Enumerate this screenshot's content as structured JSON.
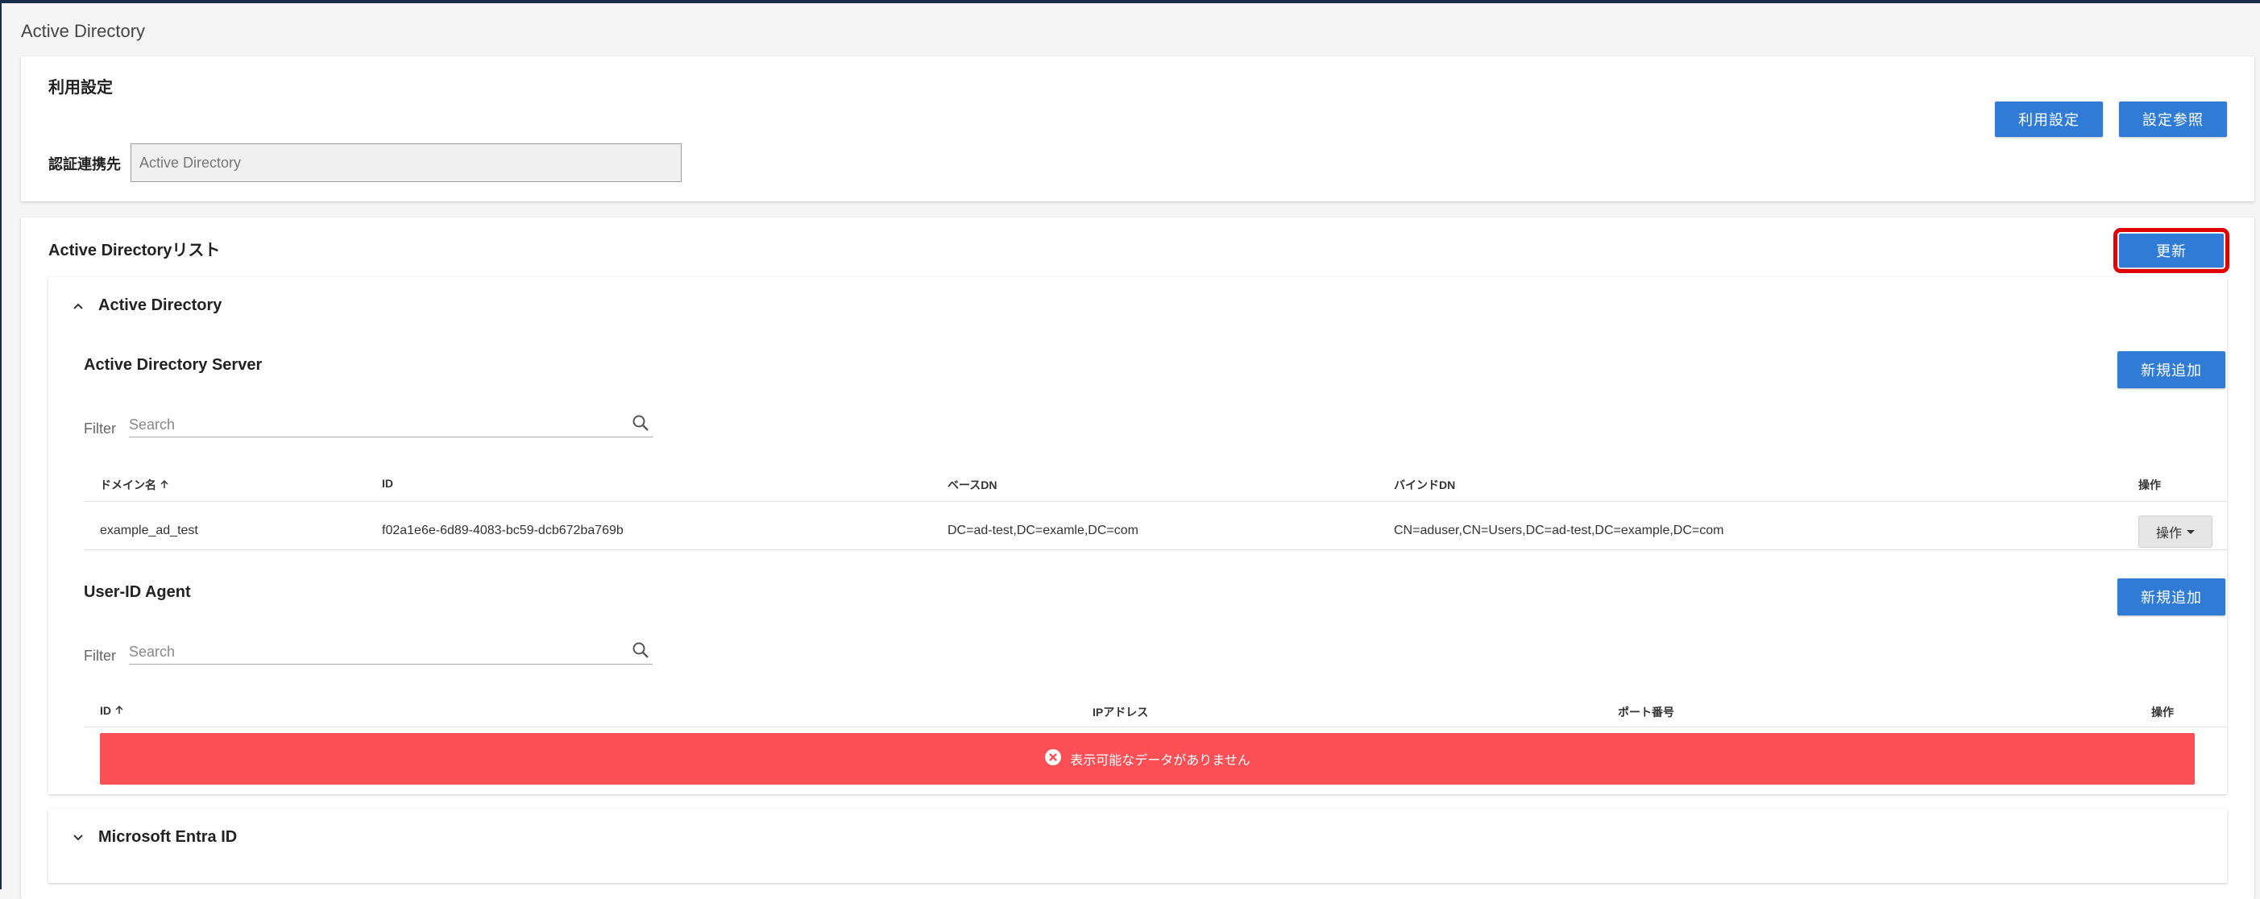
{
  "page": {
    "title": "Active Directory"
  },
  "settings": {
    "title": "利用設定",
    "auth_label": "認証連携先",
    "auth_value": "Active Directory",
    "usage_button": "利用設定",
    "view_button": "設定参照"
  },
  "ad_list": {
    "title": "Active Directoryリスト",
    "refresh_button": "更新",
    "accordion_ad": {
      "title": "Active Directory",
      "expanded": true,
      "server": {
        "title": "Active Directory Server",
        "add_button": "新規追加",
        "filter_label": "Filter",
        "search_placeholder": "Search",
        "columns": {
          "domain": "ドメイン名",
          "id": "ID",
          "base_dn": "ベースDN",
          "bind_dn": "バインドDN",
          "ops": "操作"
        },
        "rows": [
          {
            "domain": "example_ad_test",
            "id": "f02a1e6e-6d89-4083-bc59-dcb672ba769b",
            "base_dn": "DC=ad-test,DC=examle,DC=com",
            "bind_dn": "CN=aduser,CN=Users,DC=ad-test,DC=example,DC=com",
            "ops_label": "操作"
          }
        ]
      },
      "agent": {
        "title": "User-ID Agent",
        "add_button": "新規追加",
        "filter_label": "Filter",
        "search_placeholder": "Search",
        "columns": {
          "id": "ID",
          "ip": "IPアドレス",
          "port": "ポート番号",
          "ops": "操作"
        },
        "empty_message": "表示可能なデータがありません"
      }
    },
    "accordion_entra": {
      "title": "Microsoft Entra ID",
      "expanded": false
    }
  },
  "colors": {
    "primary": "#2f7bd6",
    "highlight": "#e00000",
    "alert": "#fa5055",
    "frame": "#1a2b4c"
  }
}
